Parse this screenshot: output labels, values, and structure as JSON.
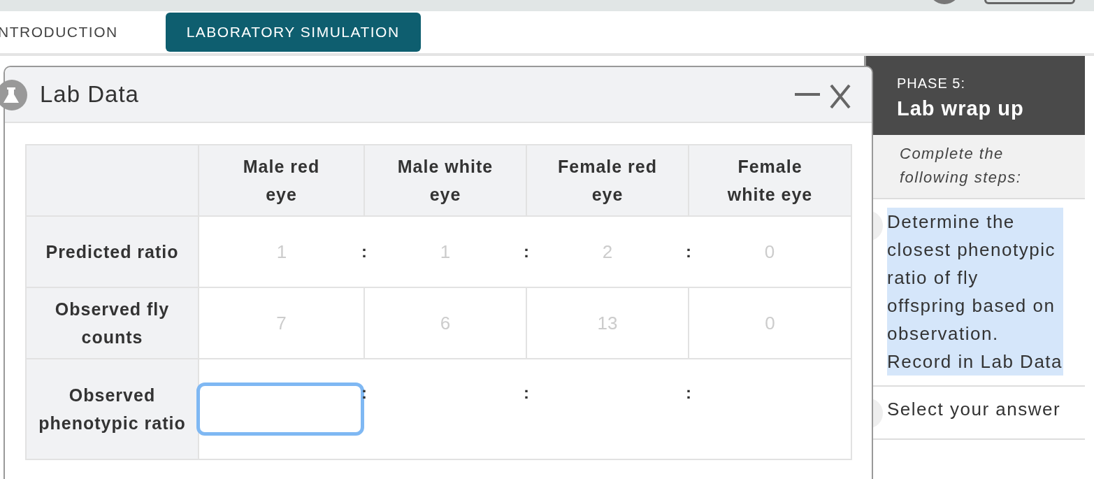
{
  "tabs": [
    {
      "label": "NTRODUCTION",
      "selected": false
    },
    {
      "label": "LABORATORY SIMULATION",
      "selected": true
    }
  ],
  "lab_data": {
    "title": "Lab Data",
    "columns": [
      "Male red eye",
      "Male white eye",
      "Female red eye",
      "Female white eye"
    ],
    "rows": [
      {
        "label": "Predicted ratio",
        "kind": "ratio",
        "separator": ":",
        "cells": [
          {
            "value": "1"
          },
          {
            "value": "1"
          },
          {
            "value": "2"
          },
          {
            "value": "0"
          }
        ]
      },
      {
        "label": "Observed fly counts",
        "kind": "counts",
        "cells": [
          {
            "value": "7"
          },
          {
            "value": "6"
          },
          {
            "value": "13"
          },
          {
            "value": "0"
          }
        ]
      },
      {
        "label": "Observed phenotypic ratio",
        "kind": "ratio",
        "separator": ":",
        "cells": [
          {
            "focused": true
          },
          {
            "focused": false
          },
          {
            "focused": false
          },
          {
            "focused": false
          }
        ]
      }
    ]
  },
  "sidebar": {
    "phase": "PHASE 5:",
    "title": "Lab wrap up",
    "instructions": "Complete the following steps:",
    "steps": [
      {
        "text": "Determine the closest phenotypic ratio of fly offspring based on observation. Record in Lab Data",
        "highlighted": true
      },
      {
        "text": "Select your answer",
        "highlighted": false
      }
    ]
  }
}
